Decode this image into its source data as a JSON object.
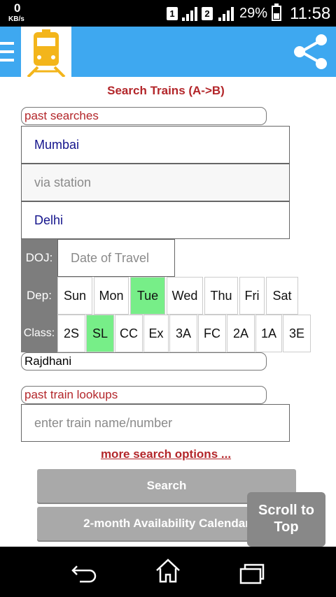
{
  "status_bar": {
    "speed_value": "0",
    "speed_unit": "KB/s",
    "sim1": "1",
    "sim2": "2",
    "battery": "29%",
    "time": "11:58"
  },
  "header": {
    "menu_icon": "hamburger-icon",
    "logo_icon": "train-icon",
    "share_icon": "share-icon",
    "color": "#3ea8f0"
  },
  "form": {
    "title": "Search Trains (A->B)",
    "past_searches": "past searches",
    "from_station": "Mumbai",
    "via_placeholder": "via station",
    "to_station": "Delhi",
    "doj_label": "DOJ:",
    "doj_placeholder": "Date of Travel",
    "dep_label": "Dep:",
    "days": [
      "Sun",
      "Mon",
      "Tue",
      "Wed",
      "Thu",
      "Fri",
      "Sat"
    ],
    "selected_day": "Tue",
    "class_label": "Class:",
    "classes": [
      "2S",
      "SL",
      "CC",
      "Ex",
      "3A",
      "FC",
      "2A",
      "1A",
      "3E"
    ],
    "selected_class": "SL",
    "train_type": "Rajdhani",
    "past_train_lookups": "past train lookups",
    "train_placeholder": "enter train name/number",
    "more_options": "more search options ...",
    "search_button": "Search",
    "calendar_button": "2-month Availability Calendar",
    "scroll_top": "Scroll to Top",
    "accent_color": "#b3262a",
    "selected_color": "#77ee88"
  },
  "nav": {
    "back_icon": "back-icon",
    "home_icon": "home-icon",
    "recents_icon": "recents-icon"
  }
}
